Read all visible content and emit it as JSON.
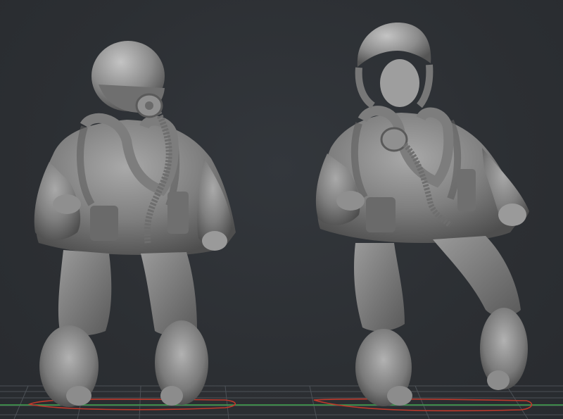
{
  "scene": {
    "background_color": "#2d3034",
    "model_color": "#8a8a8a",
    "grid_color": "#5a5e63",
    "axis_x_color": "#c0392b",
    "axis_y_color": "#3fa34d"
  },
  "models": [
    {
      "name": "pilot-figure-with-oxygen-mask"
    },
    {
      "name": "pilot-figure-without-mask"
    }
  ]
}
